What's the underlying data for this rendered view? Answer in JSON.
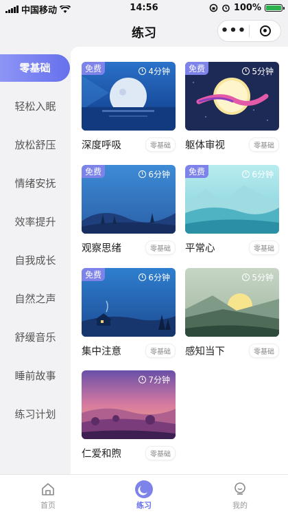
{
  "status": {
    "carrier": "中国移动",
    "time": "14:56",
    "battery": "100%"
  },
  "header": {
    "title": "练习",
    "more": "•••"
  },
  "sidebar": {
    "items": [
      {
        "label": "零基础",
        "active": true
      },
      {
        "label": "轻松入眠"
      },
      {
        "label": "放松舒压"
      },
      {
        "label": "情绪安抚"
      },
      {
        "label": "效率提升"
      },
      {
        "label": "自我成长"
      },
      {
        "label": "自然之声"
      },
      {
        "label": "舒缓音乐"
      },
      {
        "label": "睡前故事"
      },
      {
        "label": "练习计划"
      }
    ]
  },
  "cards": [
    {
      "title": "深度呼吸",
      "duration": "4分钟",
      "badge": "免费",
      "level": "零基础"
    },
    {
      "title": "躯体审视",
      "duration": "5分钟",
      "badge": "免费",
      "level": "零基础"
    },
    {
      "title": "观察思绪",
      "duration": "6分钟",
      "badge": "免费",
      "level": "零基础"
    },
    {
      "title": "平常心",
      "duration": "6分钟",
      "badge": "免费",
      "level": "零基础"
    },
    {
      "title": "集中注意",
      "duration": "6分钟",
      "badge": "免费",
      "level": "零基础"
    },
    {
      "title": "感知当下",
      "duration": "5分钟",
      "badge": "",
      "level": "零基础"
    },
    {
      "title": "仁爱和煦",
      "duration": "7分钟",
      "badge": "",
      "level": "零基础"
    }
  ],
  "tabbar": {
    "items": [
      {
        "label": "首页",
        "icon": "home-icon"
      },
      {
        "label": "练习",
        "icon": "practice-icon",
        "active": true
      },
      {
        "label": "我的",
        "icon": "profile-icon"
      }
    ]
  },
  "colors": {
    "accent": "#6670ec",
    "badge": "#7d83e8"
  }
}
